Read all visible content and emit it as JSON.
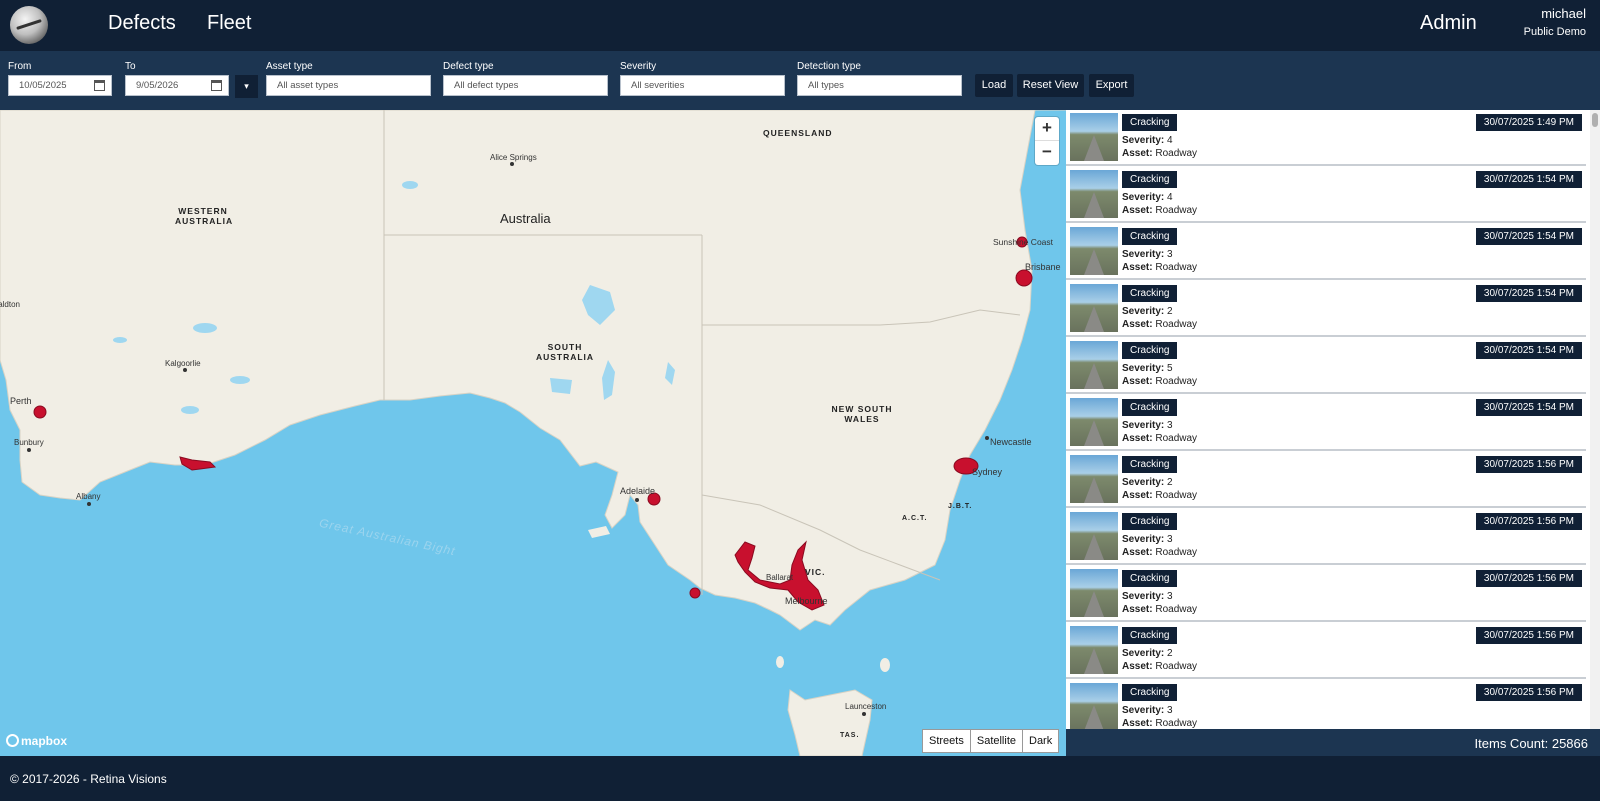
{
  "header": {
    "nav": [
      "Defects",
      "Fleet"
    ],
    "admin": "Admin",
    "user_name": "michael",
    "user_org": "Public Demo"
  },
  "filters": {
    "from_label": "From",
    "from_value": "10/05/2025",
    "to_label": "To",
    "to_value": "9/05/2026",
    "asset_label": "Asset type",
    "asset_value": "All asset types",
    "defect_label": "Defect type",
    "defect_value": "All defect types",
    "severity_label": "Severity",
    "severity_value": "All severities",
    "detection_label": "Detection type",
    "detection_value": "All types",
    "load": "Load",
    "reset": "Reset View",
    "export": "Export",
    "dropdown_icon": "▾"
  },
  "map": {
    "labels": {
      "queensland": "QUEENSLAND",
      "western_australia": "WESTERN AUSTRALIA",
      "south_australia": "SOUTH AUSTRALIA",
      "nsw": "NEW SOUTH WALES",
      "vic": "VIC.",
      "act": "A.C.T.",
      "jbt": "J.B.T.",
      "tas": "TAS.",
      "australia": "Australia",
      "alice_springs": "Alice Springs",
      "kalgoorlie": "Kalgoorlie",
      "perth": "Perth",
      "bunbury": "Bunbury",
      "albany": "Albany",
      "adelaide": "Adelaide",
      "ballarat": "Ballarat",
      "melbourne": "Melbourne",
      "sydney": "Sydney",
      "newcastle": "Newcastle",
      "brisbane": "Brisbane",
      "sunshine_coast": "Sunshine Coast",
      "launceston": "Launceston",
      "geraldton": "Geraldton",
      "bight": "Great Australian Bight"
    },
    "zoom_in": "+",
    "zoom_out": "−",
    "styles": [
      "Streets",
      "Satellite",
      "Dark"
    ],
    "attribution": "mapbox",
    "defect_color": "#c8102e"
  },
  "list": {
    "items": [
      {
        "type": "Cracking",
        "date": "30/07/2025 1:49 PM",
        "severity_label": "Severity:",
        "severity": "4",
        "asset_label": "Asset:",
        "asset": "Roadway"
      },
      {
        "type": "Cracking",
        "date": "30/07/2025 1:54 PM",
        "severity_label": "Severity:",
        "severity": "4",
        "asset_label": "Asset:",
        "asset": "Roadway"
      },
      {
        "type": "Cracking",
        "date": "30/07/2025 1:54 PM",
        "severity_label": "Severity:",
        "severity": "3",
        "asset_label": "Asset:",
        "asset": "Roadway"
      },
      {
        "type": "Cracking",
        "date": "30/07/2025 1:54 PM",
        "severity_label": "Severity:",
        "severity": "2",
        "asset_label": "Asset:",
        "asset": "Roadway"
      },
      {
        "type": "Cracking",
        "date": "30/07/2025 1:54 PM",
        "severity_label": "Severity:",
        "severity": "5",
        "asset_label": "Asset:",
        "asset": "Roadway"
      },
      {
        "type": "Cracking",
        "date": "30/07/2025 1:54 PM",
        "severity_label": "Severity:",
        "severity": "3",
        "asset_label": "Asset:",
        "asset": "Roadway"
      },
      {
        "type": "Cracking",
        "date": "30/07/2025 1:56 PM",
        "severity_label": "Severity:",
        "severity": "2",
        "asset_label": "Asset:",
        "asset": "Roadway"
      },
      {
        "type": "Cracking",
        "date": "30/07/2025 1:56 PM",
        "severity_label": "Severity:",
        "severity": "3",
        "asset_label": "Asset:",
        "asset": "Roadway"
      },
      {
        "type": "Cracking",
        "date": "30/07/2025 1:56 PM",
        "severity_label": "Severity:",
        "severity": "3",
        "asset_label": "Asset:",
        "asset": "Roadway"
      },
      {
        "type": "Cracking",
        "date": "30/07/2025 1:56 PM",
        "severity_label": "Severity:",
        "severity": "2",
        "asset_label": "Asset:",
        "asset": "Roadway"
      },
      {
        "type": "Cracking",
        "date": "30/07/2025 1:56 PM",
        "severity_label": "Severity:",
        "severity": "3",
        "asset_label": "Asset:",
        "asset": "Roadway"
      }
    ],
    "items_count": "Items Count: 25866"
  },
  "footer": {
    "copyright": "© 2017-2026 - Retina Visions"
  },
  "colors": {
    "navy": "#102035",
    "filterbar": "#1c3551",
    "ocean": "#6fc6eb",
    "land": "#f1eee5",
    "defect": "#c8102e"
  }
}
